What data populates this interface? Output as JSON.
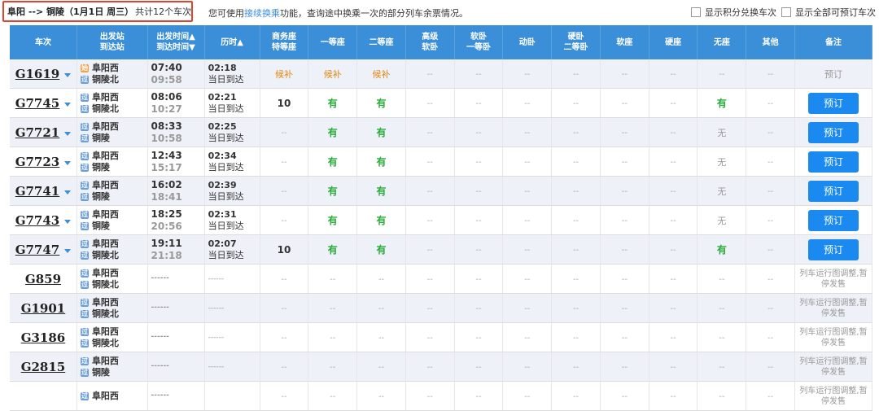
{
  "header": {
    "route": "阜阳 --> 铜陵（1月1日 周三）",
    "count": "共计12个车次",
    "tip_prefix": "您可使用",
    "tip_link": "接续换乘",
    "tip_suffix": "功能，查询途中换乘一次的部分列车余票情况。",
    "opt_points": "显示积分兑换车次",
    "opt_bookable": "显示全部可预订车次"
  },
  "columns": [
    "车次",
    "出发站\n到达站",
    "出发时间▲\n到达时间▼",
    "历时▲",
    "商务座\n特等座",
    "一等座",
    "二等座",
    "高级\n软卧",
    "软卧\n一等卧",
    "动卧",
    "硬卧\n二等卧",
    "软座",
    "硬座",
    "无座",
    "其他",
    "备注"
  ],
  "rows": [
    {
      "train": "G1619",
      "from": "阜阳西",
      "to": "铜陵北",
      "dep": "07:40",
      "arr": "09:58",
      "dur": "02:18",
      "day": "当日到达",
      "seats": [
        "候补",
        "候补",
        "候补",
        "--",
        "--",
        "--",
        "--",
        "--",
        "--",
        "--",
        "--"
      ],
      "action": "预订",
      "bookable": false,
      "dropdown": true
    },
    {
      "train": "G7745",
      "from": "阜阳西",
      "to": "铜陵北",
      "dep": "08:06",
      "arr": "10:27",
      "dur": "02:21",
      "day": "当日到达",
      "seats": [
        "10",
        "有",
        "有",
        "--",
        "--",
        "--",
        "--",
        "--",
        "--",
        "有",
        "--"
      ],
      "action": "预订",
      "bookable": true,
      "dropdown": true
    },
    {
      "train": "G7721",
      "from": "阜阳西",
      "to": "铜陵",
      "dep": "08:33",
      "arr": "10:58",
      "dur": "02:25",
      "day": "当日到达",
      "seats": [
        "--",
        "有",
        "有",
        "--",
        "--",
        "--",
        "--",
        "--",
        "--",
        "无",
        "--"
      ],
      "action": "预订",
      "bookable": true,
      "dropdown": true
    },
    {
      "train": "G7723",
      "from": "阜阳西",
      "to": "铜陵",
      "dep": "12:43",
      "arr": "15:17",
      "dur": "02:34",
      "day": "当日到达",
      "seats": [
        "--",
        "有",
        "有",
        "--",
        "--",
        "--",
        "--",
        "--",
        "--",
        "无",
        "--"
      ],
      "action": "预订",
      "bookable": true,
      "dropdown": true
    },
    {
      "train": "G7741",
      "from": "阜阳西",
      "to": "铜陵",
      "dep": "16:02",
      "arr": "18:41",
      "dur": "02:39",
      "day": "当日到达",
      "seats": [
        "--",
        "有",
        "有",
        "--",
        "--",
        "--",
        "--",
        "--",
        "--",
        "无",
        "--"
      ],
      "action": "预订",
      "bookable": true,
      "dropdown": true
    },
    {
      "train": "G7743",
      "from": "阜阳西",
      "to": "铜陵",
      "dep": "18:25",
      "arr": "20:56",
      "dur": "02:31",
      "day": "当日到达",
      "seats": [
        "--",
        "有",
        "有",
        "--",
        "--",
        "--",
        "--",
        "--",
        "--",
        "无",
        "--"
      ],
      "action": "预订",
      "bookable": true,
      "dropdown": true
    },
    {
      "train": "G7747",
      "from": "阜阳西",
      "to": "铜陵北",
      "dep": "19:11",
      "arr": "21:18",
      "dur": "02:07",
      "day": "当日到达",
      "seats": [
        "10",
        "有",
        "有",
        "--",
        "--",
        "--",
        "--",
        "--",
        "--",
        "有",
        "--"
      ],
      "action": "预订",
      "bookable": true,
      "dropdown": true
    },
    {
      "train": "G859",
      "from": "阜阳西",
      "to": "铜陵北",
      "dep": "------",
      "arr": "",
      "dur": "------",
      "day": "",
      "seats": [
        "--",
        "--",
        "--",
        "--",
        "--",
        "--",
        "--",
        "--",
        "--",
        "--",
        "--"
      ],
      "action": "列车运行图调整,暂停发售",
      "bookable": false,
      "dropdown": false
    },
    {
      "train": "G1901",
      "from": "阜阳西",
      "to": "铜陵北",
      "dep": "------",
      "arr": "",
      "dur": "------",
      "day": "",
      "seats": [
        "--",
        "--",
        "--",
        "--",
        "--",
        "--",
        "--",
        "--",
        "--",
        "--",
        "--"
      ],
      "action": "列车运行图调整,暂停发售",
      "bookable": false,
      "dropdown": false
    },
    {
      "train": "G3186",
      "from": "阜阳西",
      "to": "铜陵北",
      "dep": "------",
      "arr": "",
      "dur": "------",
      "day": "",
      "seats": [
        "--",
        "--",
        "--",
        "--",
        "--",
        "--",
        "--",
        "--",
        "--",
        "--",
        "--"
      ],
      "action": "列车运行图调整,暂停发售",
      "bookable": false,
      "dropdown": false
    },
    {
      "train": "G2815",
      "from": "阜阳西",
      "to": "铜陵",
      "dep": "------",
      "arr": "",
      "dur": "------",
      "day": "",
      "seats": [
        "--",
        "--",
        "--",
        "--",
        "--",
        "--",
        "--",
        "--",
        "--",
        "--",
        "--"
      ],
      "action": "列车运行图调整,暂停发售",
      "bookable": false,
      "dropdown": false
    },
    {
      "train": "",
      "from": "阜阳西",
      "to": "",
      "dep": "------",
      "arr": "",
      "dur": "",
      "day": "",
      "seats": [
        "--",
        "--",
        "--",
        "--",
        "--",
        "--",
        "--",
        "--",
        "--",
        "--",
        "--"
      ],
      "action": "列车运行图调整,暂停发售",
      "bookable": false,
      "dropdown": false
    }
  ],
  "icons": {
    "start": "始",
    "pass": "过"
  },
  "colors": {
    "header_bg": "#3b8fd9",
    "book_btn": "#1b8af0",
    "available": "#2bab3c",
    "candidate": "#e08a1a",
    "highlight_border": "#e0442f"
  }
}
